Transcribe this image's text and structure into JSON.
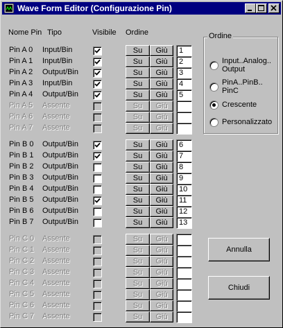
{
  "window": {
    "title": "Wave Form Editor (Configurazione Pin)",
    "title_color": "#000080",
    "controls": [
      "minimize-icon",
      "maximize-icon",
      "close-icon"
    ]
  },
  "headers": {
    "name": "Nome Pin",
    "type": "Tipo",
    "visible": "Visibile",
    "order": "Ordine"
  },
  "button_labels": {
    "up": "Su",
    "down": "Giù"
  },
  "groups": [
    {
      "rows": [
        {
          "name": "Pin A 0",
          "type": "Input/Bin",
          "visible": true,
          "enabled": true,
          "order": "1"
        },
        {
          "name": "Pin A 1",
          "type": "Input/Bin",
          "visible": true,
          "enabled": true,
          "order": "2"
        },
        {
          "name": "Pin A 2",
          "type": "Output/Bin",
          "visible": true,
          "enabled": true,
          "order": "3"
        },
        {
          "name": "Pin A 3",
          "type": "Input/Bin",
          "visible": true,
          "enabled": true,
          "order": "4"
        },
        {
          "name": "Pin A 4",
          "type": "Output/Bin",
          "visible": true,
          "enabled": true,
          "order": "5"
        },
        {
          "name": "Pin A 5",
          "type": "Assente",
          "visible": false,
          "enabled": false,
          "order": ""
        },
        {
          "name": "Pin A 6",
          "type": "Assente",
          "visible": false,
          "enabled": false,
          "order": ""
        },
        {
          "name": "Pin A 7",
          "type": "Assente",
          "visible": false,
          "enabled": false,
          "order": ""
        }
      ]
    },
    {
      "rows": [
        {
          "name": "Pin B 0",
          "type": "Output/Bin",
          "visible": true,
          "enabled": true,
          "order": "6"
        },
        {
          "name": "Pin B 1",
          "type": "Output/Bin",
          "visible": true,
          "enabled": true,
          "order": "7"
        },
        {
          "name": "Pin B 2",
          "type": "Output/Bin",
          "visible": false,
          "enabled": true,
          "order": "8"
        },
        {
          "name": "Pin B 3",
          "type": "Output/Bin",
          "visible": false,
          "enabled": true,
          "order": "9"
        },
        {
          "name": "Pin B 4",
          "type": "Output/Bin",
          "visible": false,
          "enabled": true,
          "order": "10"
        },
        {
          "name": "Pin B 5",
          "type": "Output/Bin",
          "visible": true,
          "enabled": true,
          "order": "11"
        },
        {
          "name": "Pin B 6",
          "type": "Output/Bin",
          "visible": false,
          "enabled": true,
          "order": "12"
        },
        {
          "name": "Pin B 7",
          "type": "Output/Bin",
          "visible": false,
          "enabled": true,
          "order": "13"
        }
      ]
    },
    {
      "rows": [
        {
          "name": "Pin C 0",
          "type": "Assente",
          "visible": false,
          "enabled": false,
          "order": ""
        },
        {
          "name": "Pin C 1",
          "type": "Assente",
          "visible": false,
          "enabled": false,
          "order": ""
        },
        {
          "name": "Pin C 2",
          "type": "Assente",
          "visible": false,
          "enabled": false,
          "order": ""
        },
        {
          "name": "Pin C 3",
          "type": "Assente",
          "visible": false,
          "enabled": false,
          "order": ""
        },
        {
          "name": "Pin C 4",
          "type": "Assente",
          "visible": false,
          "enabled": false,
          "order": ""
        },
        {
          "name": "Pin C 5",
          "type": "Assente",
          "visible": false,
          "enabled": false,
          "order": ""
        },
        {
          "name": "Pin C 6",
          "type": "Assente",
          "visible": false,
          "enabled": false,
          "order": ""
        },
        {
          "name": "Pin C 7",
          "type": "Assente",
          "visible": false,
          "enabled": false,
          "order": ""
        }
      ]
    }
  ],
  "ordine": {
    "label": "Ordine",
    "options": [
      {
        "label": "Input..Analog..\nOutput",
        "checked": false
      },
      {
        "label": "PinA..PinB..\nPinC",
        "checked": false
      },
      {
        "label": "Crescente",
        "checked": true
      },
      {
        "label": "Personalizzato",
        "checked": false
      }
    ]
  },
  "buttons": {
    "cancel": "Annulla",
    "close": "Chiudi"
  }
}
